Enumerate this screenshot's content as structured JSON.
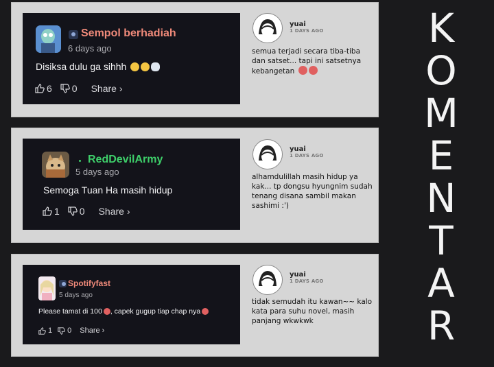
{
  "side_title": [
    "K",
    "O",
    "M",
    "E",
    "N",
    "T",
    "A",
    "R"
  ],
  "posts": [
    {
      "author": "Sempol berhadiah",
      "author_color": "#f08a7a",
      "time": "6 days ago",
      "text": "Disiksa dulu ga sihhh",
      "likes": "6",
      "dislikes": "0",
      "share": "Share ›",
      "reply": {
        "name": "yuai",
        "time": "1 DAYS AGO",
        "text": "semua terjadi secara tiba-tiba dan satset... tapi ini satsetnya kebangetan"
      }
    },
    {
      "author": "RedDevilArmy",
      "author_color": "#3ecf6a",
      "time": "5 days ago",
      "text": "Semoga Tuan Ha masih hidup",
      "likes": "1",
      "dislikes": "0",
      "share": "Share ›",
      "reply": {
        "name": "yuai",
        "time": "1 DAYS AGO",
        "text": "alhamdulillah masih hidup ya kak... tp dongsu hyungnim sudah tenang disana sambil makan sashimi :')"
      }
    },
    {
      "author": "Spotifyfast",
      "author_color": "#f08a7a",
      "time": "5 days ago",
      "text": "Please tamat di 100",
      "text2": ", capek gugup tiap chap nya",
      "likes": "1",
      "dislikes": "0",
      "share": "Share ›",
      "reply": {
        "name": "yuai",
        "time": "1 DAYS AGO",
        "text": "tidak semudah itu kawan~~ kalo kata para suhu novel, masih panjang wkwkwk"
      }
    }
  ]
}
